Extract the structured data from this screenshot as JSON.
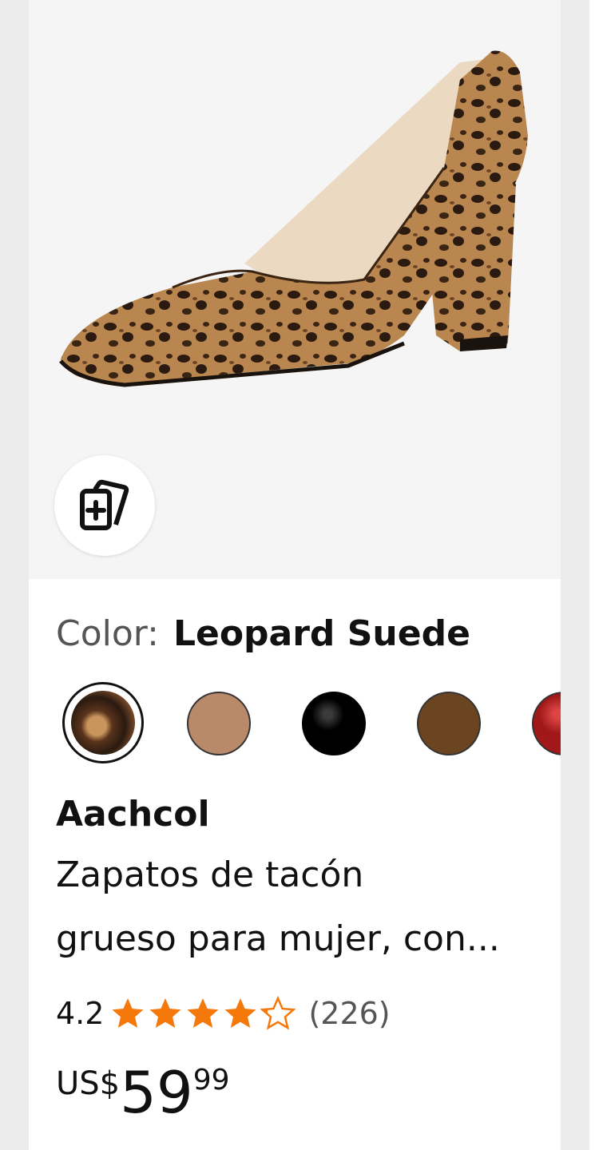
{
  "product": {
    "color_label": "Color:",
    "color_value": "Leopard Suede",
    "brand": "Aachcol",
    "title_line1": "Zapatos de tacón",
    "title_line2": "grueso para mujer, con...",
    "rating": "4.2",
    "rating_fraction": 0.84,
    "review_count": "(226)",
    "price_currency": "US$",
    "price_whole": "59",
    "price_fraction": "99"
  },
  "swatches": [
    {
      "name": "Leopard Suede",
      "color": "#7a4a2a",
      "selected": true
    },
    {
      "name": "tan",
      "color": "#b88a6a"
    },
    {
      "name": "black",
      "color": "#000000"
    },
    {
      "name": "brown",
      "color": "#6b4420"
    },
    {
      "name": "red",
      "color": "#a01818"
    }
  ],
  "colors": {
    "star": "#f5780a",
    "image_bg": "#f5f5f5"
  },
  "icons": {
    "compare": "card-compare-icon",
    "star": "star-icon"
  }
}
